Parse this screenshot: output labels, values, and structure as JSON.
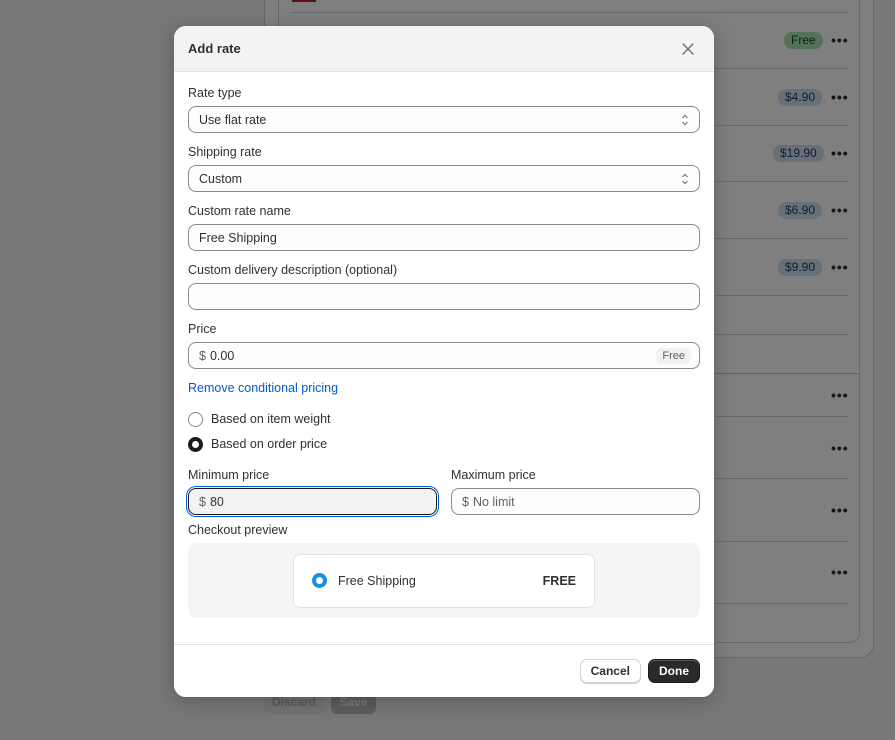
{
  "background": {
    "rate_badges": [
      {
        "label": "Free",
        "kind": "free"
      },
      {
        "label": "$4.90",
        "kind": "price"
      },
      {
        "label": "$19.90",
        "kind": "price"
      },
      {
        "label": "$6.90",
        "kind": "price"
      },
      {
        "label": "$9.90",
        "kind": "price"
      }
    ],
    "more_actions_glyph": "•••",
    "discard_label": "Discard",
    "save_label": "Save"
  },
  "modal": {
    "title": "Add rate",
    "close_icon": "close-icon",
    "rate_type": {
      "label": "Rate type",
      "value": "Use flat rate"
    },
    "shipping_rate": {
      "label": "Shipping rate",
      "value": "Custom"
    },
    "custom_rate_name": {
      "label": "Custom rate name",
      "value": "Free Shipping"
    },
    "delivery_description": {
      "label": "Custom delivery description (optional)",
      "value": ""
    },
    "price": {
      "label": "Price",
      "prefix": "$",
      "value": "0.00",
      "suffix_chip": "Free"
    },
    "remove_conditional_link": "Remove conditional pricing",
    "condition_options": [
      {
        "label": "Based on item weight",
        "checked": false
      },
      {
        "label": "Based on order price",
        "checked": true
      }
    ],
    "minimum_price": {
      "label": "Minimum price",
      "prefix": "$",
      "value": "80"
    },
    "maximum_price": {
      "label": "Maximum price",
      "prefix": "$",
      "placeholder": "No limit"
    },
    "checkout_preview": {
      "label": "Checkout preview",
      "rate_name": "Free Shipping",
      "rate_price": "FREE"
    },
    "footer": {
      "cancel_label": "Cancel",
      "done_label": "Done"
    }
  }
}
